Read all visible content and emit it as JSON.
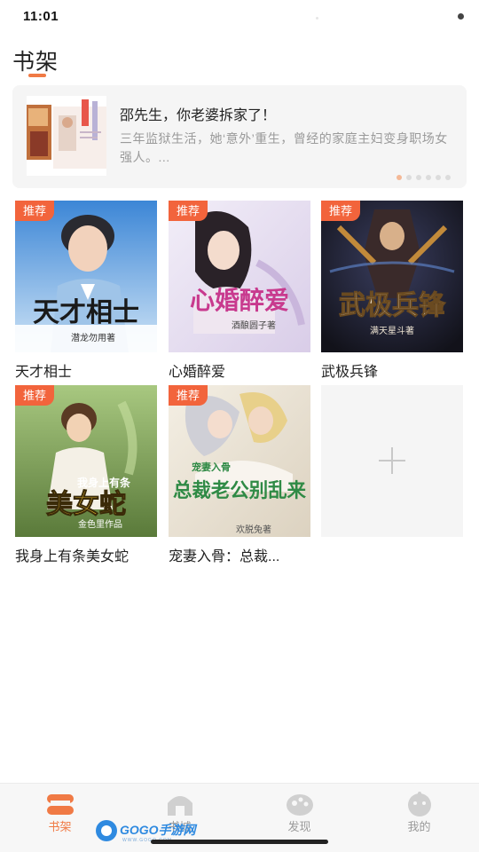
{
  "status_bar": {
    "time": "11:01"
  },
  "page": {
    "title": "书架",
    "accent_color": "#f07a45"
  },
  "banner": {
    "title": "邵先生，你老婆拆家了！",
    "description": "三年监狱生活，她‘意外’重生，曾经的家庭主妇变身职场女强人。...",
    "dots": 6,
    "active_dot": 0,
    "cover_text": "邵先生你老婆拆家了"
  },
  "books": [
    {
      "title": "天才相士",
      "badge": "推荐",
      "cover_title": "天才相士",
      "cover_author": "潜龙勿用著",
      "cover_palette": [
        "#2f73c9",
        "#b7d7f0"
      ]
    },
    {
      "title": "心婚醉爱",
      "badge": "推荐",
      "cover_title": "心婚醉爱",
      "cover_author": "酒酿圆子著",
      "cover_palette": [
        "#e8e2f2",
        "#d04a9a"
      ]
    },
    {
      "title": "武极兵锋",
      "badge": "推荐",
      "cover_title": "武极兵锋",
      "cover_author": "满天星斗著",
      "cover_palette": [
        "#1a1c28",
        "#c28a3a"
      ]
    },
    {
      "title": "我身上有条美女蛇",
      "badge": "推荐",
      "cover_title": "美女蛇",
      "cover_subtitle": "我身上有条",
      "cover_author": "金色里作品",
      "cover_palette": [
        "#7ba85a",
        "#f2c232"
      ]
    },
    {
      "title": "宠妻入骨：总裁...",
      "badge": "推荐",
      "cover_title": "总裁老公别乱来",
      "cover_subtitle": "宠妻入骨",
      "cover_author": "欢脱兔著",
      "cover_palette": [
        "#e9e3d6",
        "#2f8a45"
      ]
    }
  ],
  "add_tile": {
    "icon": "plus-icon"
  },
  "tabs": [
    {
      "label": "书架",
      "icon": "bookshelf-icon",
      "active": true
    },
    {
      "label": "书城",
      "icon": "bookstore-icon",
      "active": false
    },
    {
      "label": "发现",
      "icon": "discover-icon",
      "active": false
    },
    {
      "label": "我的",
      "icon": "profile-icon",
      "active": false
    }
  ],
  "watermark": {
    "text": "GOGO手游网",
    "subtext": "WWW.GOGO.COM"
  },
  "colors": {
    "badge": "#f2643c",
    "tab_active": "#f07a45",
    "tab_inactive": "#9a9a9a"
  }
}
